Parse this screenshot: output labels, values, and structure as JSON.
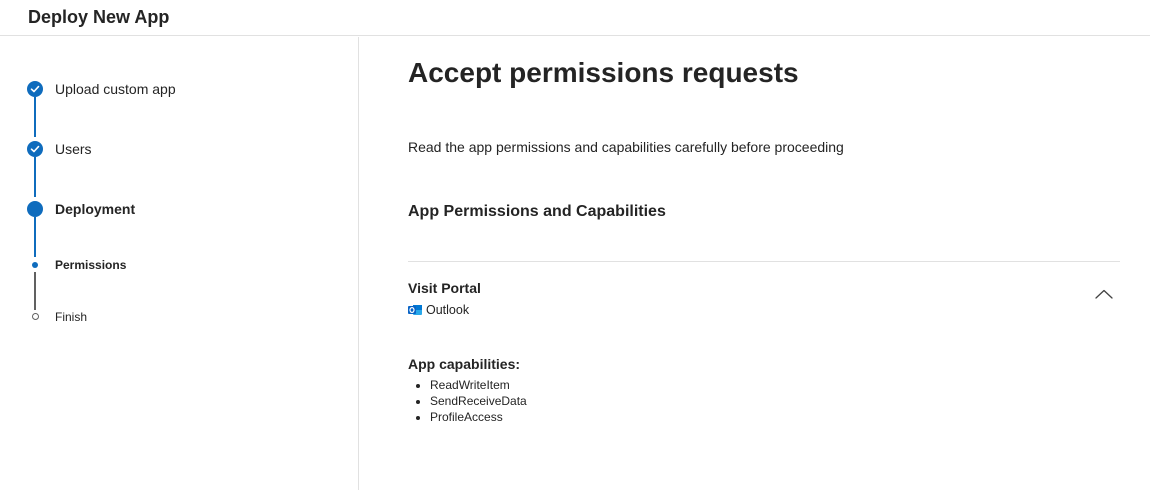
{
  "header": {
    "title": "Deploy New App"
  },
  "steps": [
    {
      "label": "Upload custom app",
      "state": "completed"
    },
    {
      "label": "Users",
      "state": "completed"
    },
    {
      "label": "Deployment",
      "state": "current"
    },
    {
      "label": "Permissions",
      "state": "current-substep"
    },
    {
      "label": "Finish",
      "state": "pending"
    }
  ],
  "main": {
    "title": "Accept permissions requests",
    "description": "Read the app permissions and capabilities carefully before proceeding",
    "section_title": "App Permissions and Capabilities",
    "portal": {
      "title": "Visit Portal",
      "app_name": "Outlook",
      "app_icon": "outlook-icon",
      "toggle_icon": "chevron-up-icon",
      "expanded": true
    },
    "capabilities": {
      "title": "App capabilities:",
      "items": [
        "ReadWriteItem",
        "SendReceiveData",
        "ProfileAccess"
      ]
    }
  },
  "colors": {
    "accent": "#0f6cbd",
    "pending": "#616161",
    "divider": "#e1e1e1",
    "outlook": "#0a64c6"
  }
}
